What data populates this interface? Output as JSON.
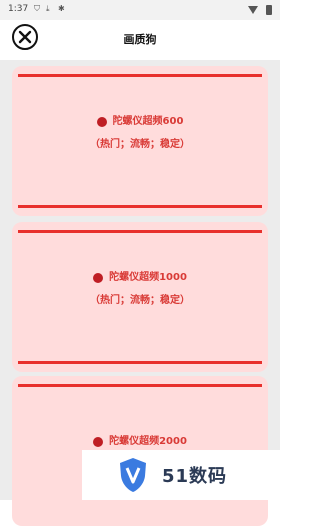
{
  "status": {
    "time": "1:37",
    "icons": [
      "shield-status-icon",
      "download-icon",
      "debug-icon",
      "wifi-icon",
      "battery-icon"
    ]
  },
  "header": {
    "title": "画质狗"
  },
  "cards": [
    {
      "title": "陀螺仪超频600",
      "tags": "（热门；流畅；稳定）"
    },
    {
      "title": "陀螺仪超频1000",
      "tags": "（热门；流畅；稳定）"
    },
    {
      "title": "陀螺仪超频2000",
      "tags": ""
    }
  ],
  "watermark": {
    "text": "51数码"
  },
  "colors": {
    "card_bg": "#ffdcdc",
    "accent": "#e8302c",
    "text": "#d93a36",
    "dot": "#bf1e24"
  }
}
